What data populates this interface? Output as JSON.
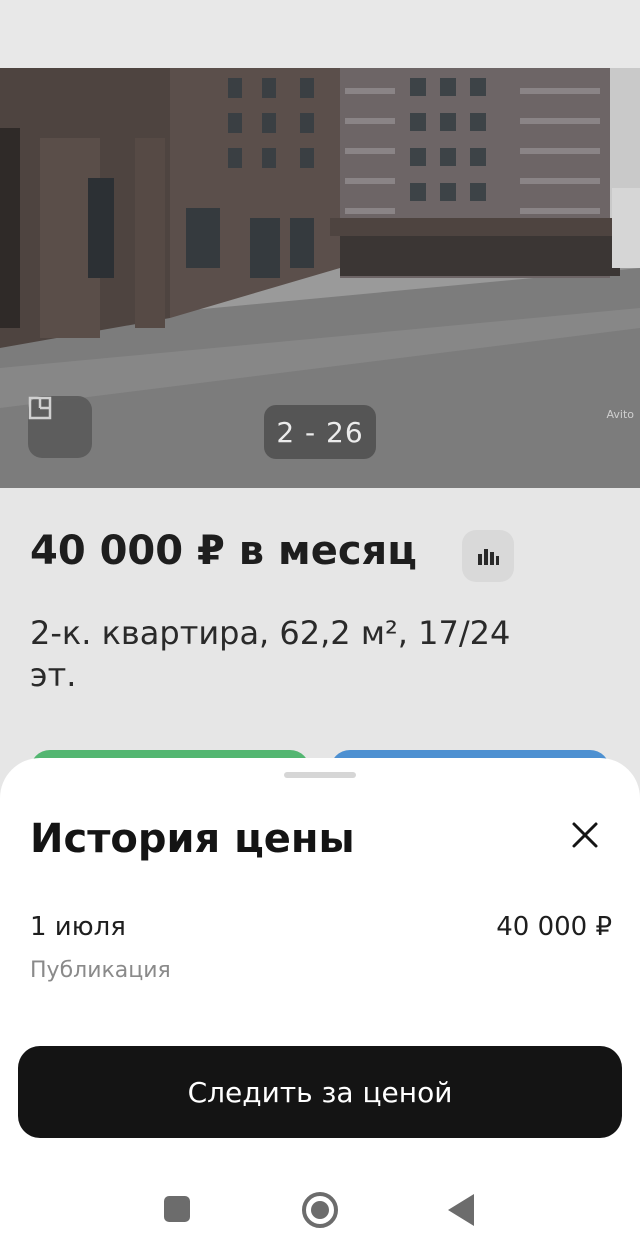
{
  "gallery": {
    "counter": "2 - 26",
    "watermark": "Avito"
  },
  "listing": {
    "price": "40 000 ₽ в месяц",
    "title": "2-к. квартира, 62,2 м², 17/24 эт."
  },
  "price_history": {
    "title": "История цены",
    "entries": [
      {
        "date": "1 июля",
        "price": "40 000 ₽",
        "event": "Публикация"
      }
    ],
    "follow_button": "Следить за ценой"
  },
  "colors": {
    "sheet_background": "#ffffff",
    "primary_button": "#141414",
    "green_button": "#21a54a",
    "blue_button": "#1a73c9"
  },
  "icons": {
    "floor_plan": "floor-plan-icon",
    "price_chart": "bar-chart-icon",
    "close": "close-icon",
    "nav_recent": "square-icon",
    "nav_home": "circle-icon",
    "nav_back": "triangle-back-icon"
  }
}
